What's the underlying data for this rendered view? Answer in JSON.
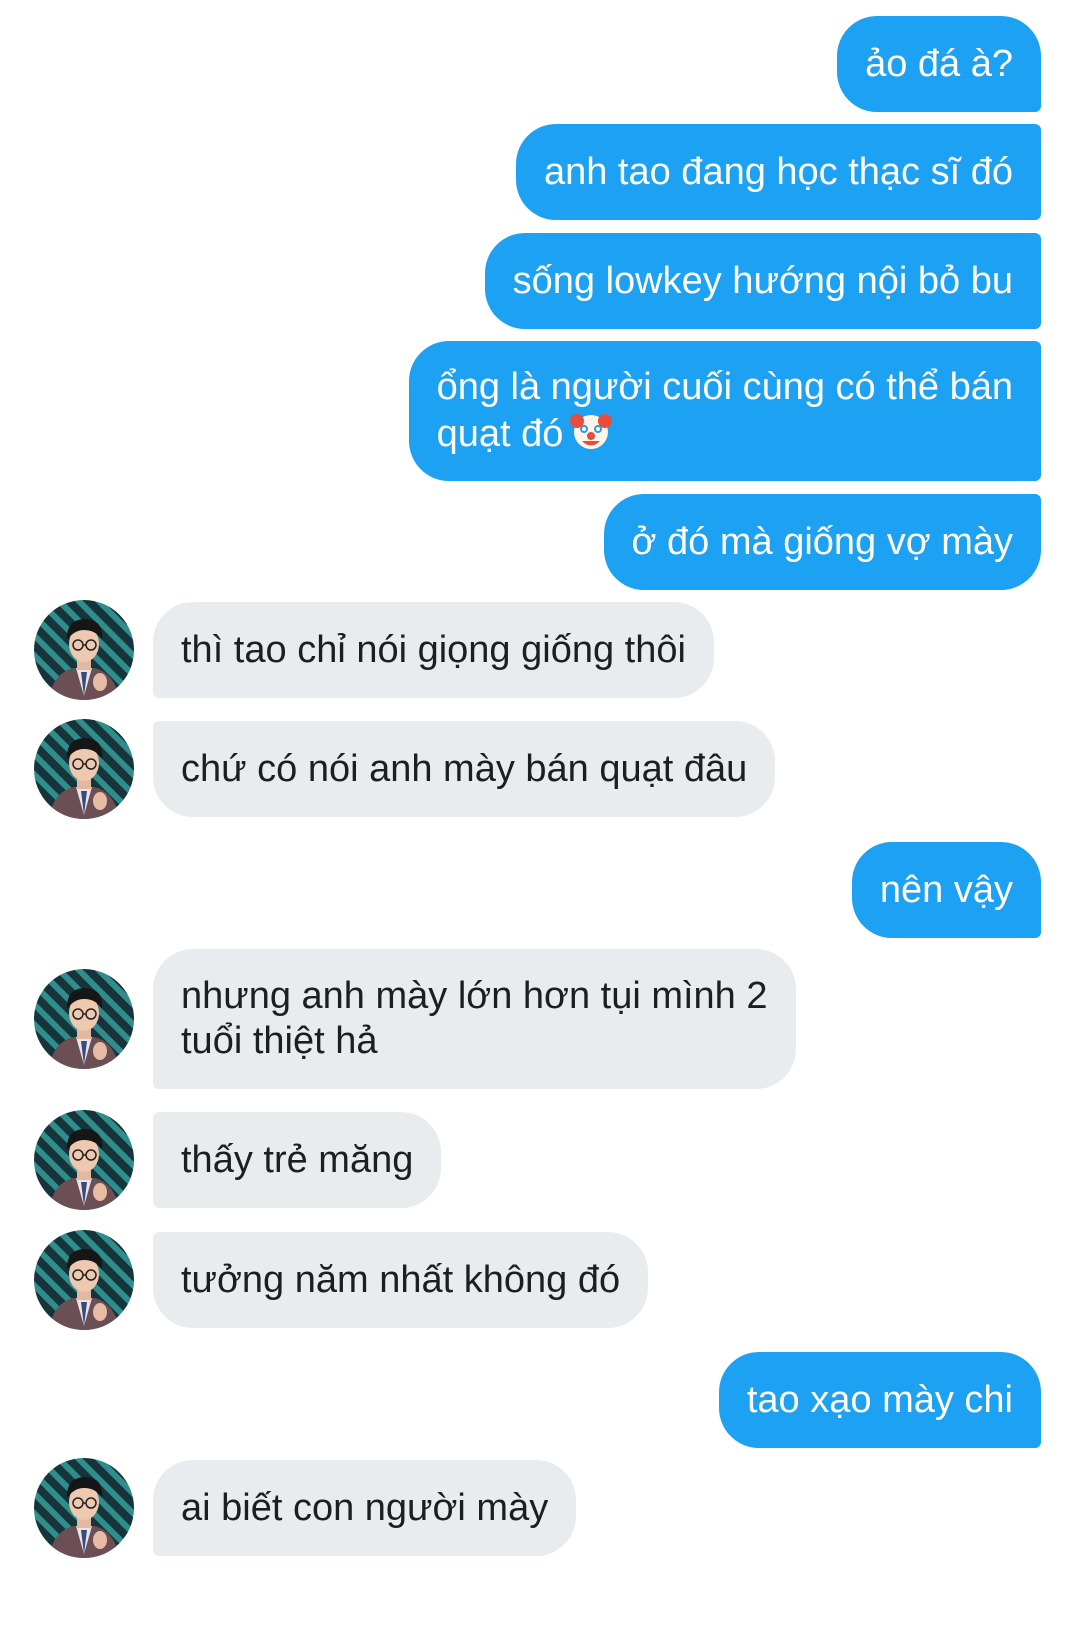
{
  "conversation": {
    "messages": [
      {
        "from": "me",
        "text": "ảo đá à?"
      },
      {
        "from": "me",
        "text": "anh tao đang học thạc sĩ đó"
      },
      {
        "from": "me",
        "text": "sống lowkey hướng nội bỏ bu"
      },
      {
        "from": "me",
        "text": "ổng là người cuối cùng có thể bán\nquạt đó",
        "emoji": "clown-face-emoji"
      },
      {
        "from": "me",
        "text": "ở đó mà giống vợ mày"
      },
      {
        "from": "them",
        "text": "thì tao chỉ nói giọng giống thôi"
      },
      {
        "from": "them",
        "text": "chứ có nói anh mày bán quạt đâu"
      },
      {
        "from": "me",
        "text": "nên vậy"
      },
      {
        "from": "them",
        "text": "nhưng anh mày lớn hơn tụi mình 2\ntuổi thiệt hả"
      },
      {
        "from": "them",
        "text": "thấy trẻ măng"
      },
      {
        "from": "them",
        "text": "tưởng năm nhất không đó"
      },
      {
        "from": "me",
        "text": "tao xạo mày chi"
      },
      {
        "from": "them",
        "text": "ai biết con người mày"
      }
    ]
  },
  "colors": {
    "sent_bubble": "#1da1f2",
    "received_bubble": "#e9ecef",
    "background": "#ffffff"
  }
}
